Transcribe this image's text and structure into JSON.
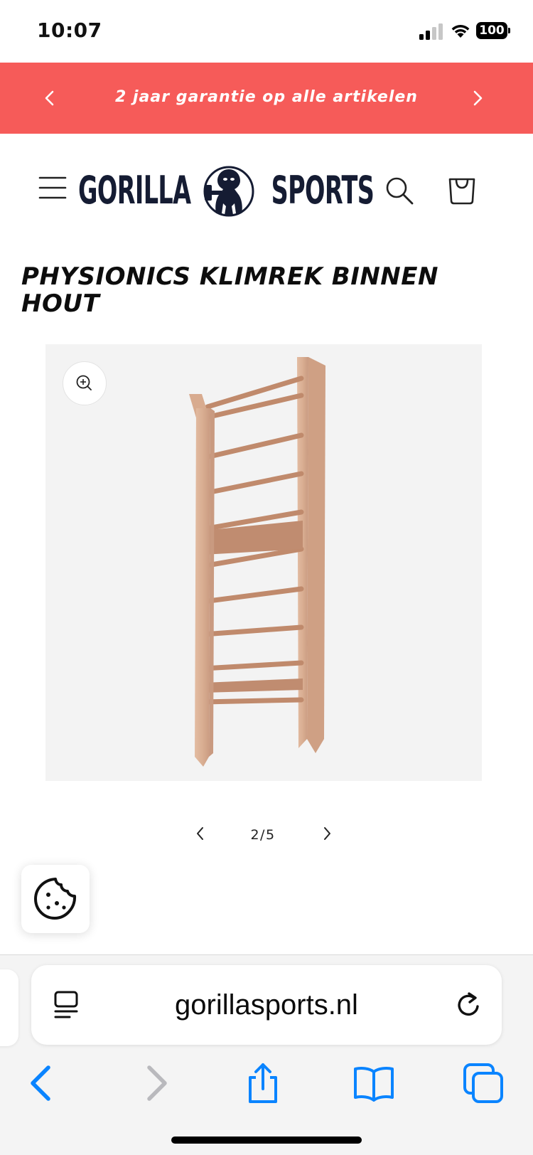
{
  "status_bar": {
    "time": "10:07",
    "battery": "100"
  },
  "announcement": {
    "text": "2 jaar garantie op alle artikelen"
  },
  "header": {
    "logo_left": "GORILLA",
    "logo_right": "SPORTS"
  },
  "product": {
    "title": "PHYSIONICS KLIMREK BINNEN HOUT"
  },
  "gallery": {
    "counter": "2/5"
  },
  "browser": {
    "url": "gorillasports.nl"
  },
  "colors": {
    "announcement_bg": "#f65b59",
    "logo": "#151c33",
    "safari_blue": "#0a84ff"
  }
}
